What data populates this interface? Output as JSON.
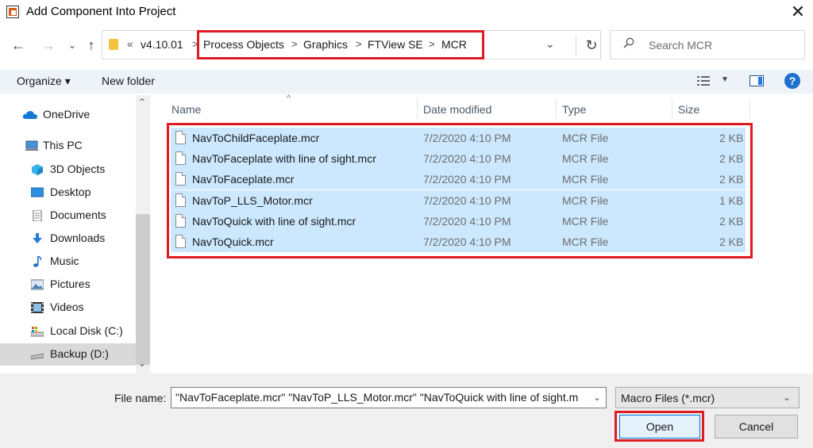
{
  "window": {
    "title": "Add Component Into Project"
  },
  "nav": {
    "back_icon": "arrow-left-icon",
    "forward_icon": "arrow-right-icon",
    "recent_icon": "chevron-down-icon",
    "up_icon": "arrow-up-icon"
  },
  "address": {
    "overflow": "«",
    "root": "v4.10.01",
    "crumbs": [
      "Process Objects",
      "Graphics",
      "FTView SE",
      "MCR"
    ],
    "separator": ">"
  },
  "search": {
    "placeholder": "Search MCR"
  },
  "toolbar": {
    "organize": "Organize ▾",
    "new_folder": "New folder",
    "help": "?"
  },
  "sidebar": {
    "items": [
      {
        "label": "OneDrive",
        "icon": "cloud-icon"
      },
      {
        "label": "This PC",
        "icon": "computer-icon"
      },
      {
        "label": "3D Objects",
        "icon": "cube-icon"
      },
      {
        "label": "Desktop",
        "icon": "desktop-icon"
      },
      {
        "label": "Documents",
        "icon": "document-icon"
      },
      {
        "label": "Downloads",
        "icon": "download-icon"
      },
      {
        "label": "Music",
        "icon": "music-icon"
      },
      {
        "label": "Pictures",
        "icon": "picture-icon"
      },
      {
        "label": "Videos",
        "icon": "video-icon"
      },
      {
        "label": "Local Disk (C:)",
        "icon": "drive-icon"
      },
      {
        "label": "Backup (D:)",
        "icon": "drive-icon"
      }
    ]
  },
  "columns": {
    "name": "Name",
    "date": "Date modified",
    "type": "Type",
    "size": "Size"
  },
  "files": [
    {
      "name": "NavToChildFaceplate.mcr",
      "date": "7/2/2020 4:10 PM",
      "type": "MCR File",
      "size": "2 KB"
    },
    {
      "name": "NavToFaceplate with line of sight.mcr",
      "date": "7/2/2020 4:10 PM",
      "type": "MCR File",
      "size": "2 KB"
    },
    {
      "name": "NavToFaceplate.mcr",
      "date": "7/2/2020 4:10 PM",
      "type": "MCR File",
      "size": "2 KB"
    },
    {
      "name": "NavToP_LLS_Motor.mcr",
      "date": "7/2/2020 4:10 PM",
      "type": "MCR File",
      "size": "1 KB"
    },
    {
      "name": "NavToQuick with line of sight.mcr",
      "date": "7/2/2020 4:10 PM",
      "type": "MCR File",
      "size": "2 KB"
    },
    {
      "name": "NavToQuick.mcr",
      "date": "7/2/2020 4:10 PM",
      "type": "MCR File",
      "size": "2 KB"
    }
  ],
  "bottom": {
    "file_name_label": "File name:",
    "file_name_value": "\"NavToFaceplate.mcr\" \"NavToP_LLS_Motor.mcr\" \"NavToQuick with line of sight.m",
    "filter": "Macro Files (*.mcr)",
    "open": "Open",
    "cancel": "Cancel"
  },
  "colors": {
    "highlight": "#e11b22",
    "selection": "#cce8ff",
    "accent": "#0078d7"
  }
}
